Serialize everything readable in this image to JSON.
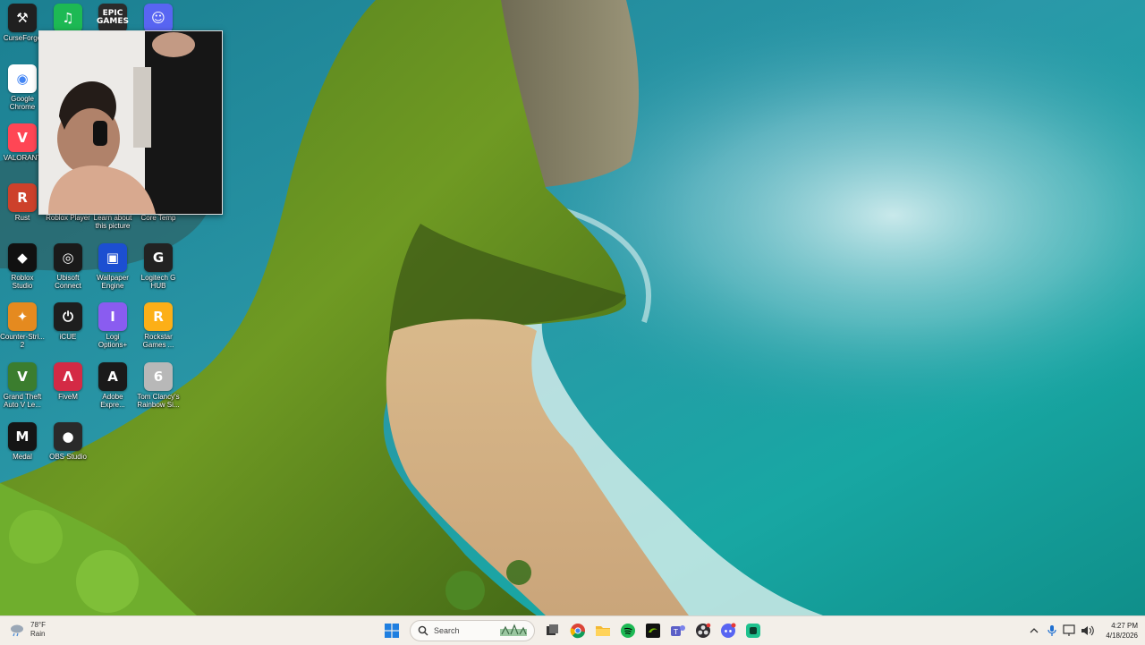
{
  "desktop": {
    "icons": [
      {
        "id": "curseforge",
        "label": "CurseForge",
        "color": "#202020",
        "glyph": "anvil-icon"
      },
      {
        "id": "spotify",
        "label": "",
        "color": "#1db954",
        "glyph": "spotify-icon"
      },
      {
        "id": "epic",
        "label": "",
        "color": "#2b2b2b",
        "glyph": "epic-games-icon",
        "text": "EPIC\nGAMES"
      },
      {
        "id": "discord",
        "label": "",
        "color": "#5865f2",
        "glyph": "discord-icon"
      },
      {
        "id": "chrome",
        "label": "Google\nChrome",
        "color": "#ffffff",
        "glyph": "chrome-icon"
      },
      {
        "id": "valorant",
        "label": "VALORANT",
        "color": "#ff4655",
        "glyph": "valorant-icon"
      },
      {
        "id": "rust",
        "label": "Rust",
        "color": "#cd412b",
        "glyph": "rust-icon"
      },
      {
        "id": "roblox-player",
        "label": "Roblox Player",
        "color": "#222222",
        "glyph": "roblox-icon"
      },
      {
        "id": "learn",
        "label": "Learn about\nthis picture",
        "color": "#3a6fd8",
        "glyph": "camera-icon"
      },
      {
        "id": "core-temp",
        "label": "Core Temp",
        "color": "#555555",
        "glyph": "thermometer-icon"
      },
      {
        "id": "roblox-studio",
        "label": "Roblox\nStudio",
        "color": "#111111",
        "glyph": "roblox-studio-icon"
      },
      {
        "id": "ubisoft",
        "label": "Ubisoft\nConnect",
        "color": "#1a1a1a",
        "glyph": "ubisoft-icon"
      },
      {
        "id": "wallpaper-engine",
        "label": "Wallpaper\nEngine",
        "color": "#1c4fd1",
        "glyph": "wallpaper-engine-icon"
      },
      {
        "id": "logitech",
        "label": "Logitech G\nHUB",
        "color": "#222222",
        "glyph": "logitech-g-icon"
      },
      {
        "id": "cs2",
        "label": "Counter-Stri...\n2",
        "color": "#e58a1f",
        "glyph": "counter-strike-icon"
      },
      {
        "id": "icue",
        "label": "iCUE",
        "color": "#1e1e1e",
        "glyph": "icue-icon"
      },
      {
        "id": "logi-options",
        "label": "Logi\nOptions+",
        "color": "#8a5cf0",
        "glyph": "logi-options-icon"
      },
      {
        "id": "rockstar",
        "label": "Rockstar\nGames ...",
        "color": "#fcaf17",
        "glyph": "rockstar-icon"
      },
      {
        "id": "gta5",
        "label": "Grand Theft\nAuto V Le...",
        "color": "#3b7d2e",
        "glyph": "gta-icon"
      },
      {
        "id": "fivem",
        "label": "FiveM",
        "color": "#d42a45",
        "glyph": "fivem-icon"
      },
      {
        "id": "adobe-express",
        "label": "Adobe\nExpre...",
        "color": "#1a1a1a",
        "glyph": "adobe-express-icon"
      },
      {
        "id": "rainbow-six",
        "label": "Tom Clancy's\nRainbow Si...",
        "color": "#b8b8b8",
        "glyph": "rainbow-six-icon"
      },
      {
        "id": "medal",
        "label": "Medal",
        "color": "#151515",
        "glyph": "medal-icon"
      },
      {
        "id": "obs",
        "label": "OBS Studio",
        "color": "#2a2a2a",
        "glyph": "obs-icon"
      }
    ]
  },
  "taskbar": {
    "weather": {
      "temp": "78°F",
      "condition": "Rain"
    },
    "search_placeholder": "Search",
    "apps": [
      "start-icon",
      "search",
      "task-view-icon",
      "chrome-icon",
      "file-explorer-icon",
      "spotify-icon",
      "nvidia-icon",
      "teams-icon",
      "obs-icon",
      "discord-icon",
      "app-icon"
    ],
    "discord_badge": "",
    "clock": {
      "time": "4:27 PM",
      "date": "4/18/2026"
    }
  }
}
